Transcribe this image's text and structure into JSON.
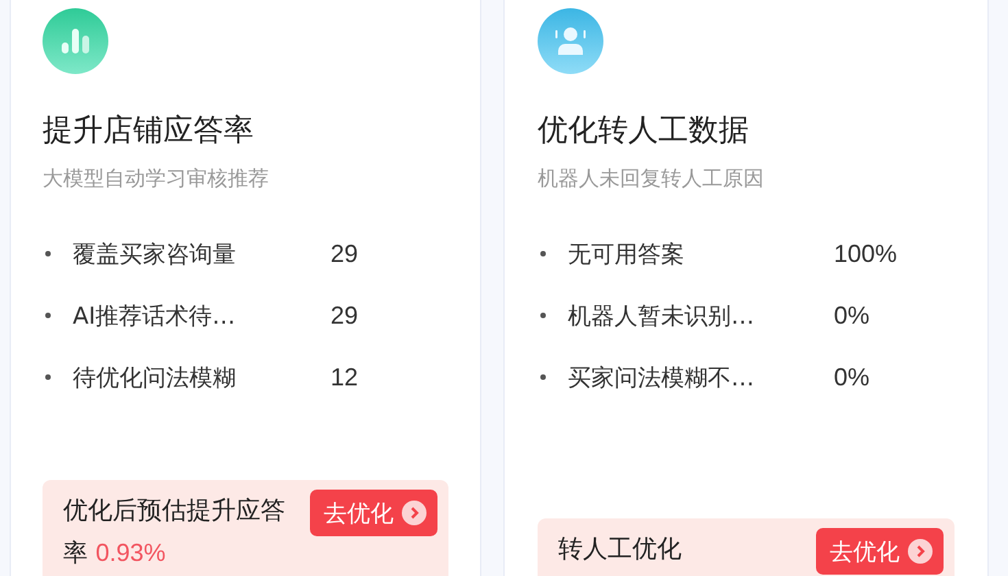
{
  "cards": [
    {
      "title": "提升店铺应答率",
      "subtitle": "大模型自动学习审核推荐",
      "items": [
        {
          "label": "覆盖买家咨询量",
          "value": "29"
        },
        {
          "label": "AI推荐话术待…",
          "value": "29"
        },
        {
          "label": "待优化问法模糊",
          "value": "12"
        }
      ],
      "promo": {
        "text": "优化后预估提升应答率",
        "highlight": "0.93%",
        "button": "去优化"
      }
    },
    {
      "title": "优化转人工数据",
      "subtitle": "机器人未回复转人工原因",
      "items": [
        {
          "label": "无可用答案",
          "value": "100%"
        },
        {
          "label": "机器人暂未识别…",
          "value": "0%"
        },
        {
          "label": "买家问法模糊不…",
          "value": "0%"
        }
      ],
      "promo": {
        "text": "转人工优化",
        "button": "去优化"
      }
    }
  ]
}
